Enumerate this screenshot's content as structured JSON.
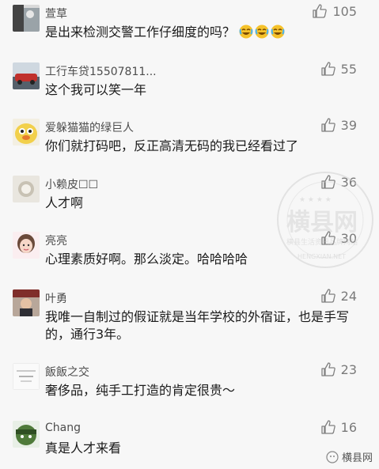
{
  "comments": [
    {
      "name": "萱草",
      "content": "是出来检测交警工作仔细度的吗？",
      "likes": "105",
      "emoji_count": 3
    },
    {
      "name": "工行车贷15507811...",
      "content": "这个我可以笑一年",
      "likes": "55"
    },
    {
      "name": "爱躲猫猫的绿巨人",
      "content": "你们就打码吧，反正高清无码的我已经看过了",
      "likes": "39"
    },
    {
      "name": "小赖皮☐☐",
      "content": "人才啊",
      "likes": "36"
    },
    {
      "name": "亮亮",
      "content": "心理素质好啊。那么淡定。哈哈哈哈",
      "likes": "30"
    },
    {
      "name": "叶勇",
      "content": "我唯一自制过的假证就是当年学校的外宿证，也是手写的，通行3年。",
      "likes": "24"
    },
    {
      "name": "飯飯之交",
      "content": "奢侈品，纯手工打造的肯定很贵～",
      "likes": "23"
    },
    {
      "name": "Chang",
      "content": "真是人才来看",
      "likes": "16"
    }
  ],
  "watermark": {
    "main": "横县网",
    "sub": "横县生活资讯品牌网站",
    "url": "HENGXIAN.NET"
  },
  "footer": {
    "brand": "横县网"
  },
  "colors": {
    "background": "#f7f7f7",
    "name": "#4d4d4d",
    "content": "#1a1a1a",
    "like": "#7a7a7a"
  }
}
